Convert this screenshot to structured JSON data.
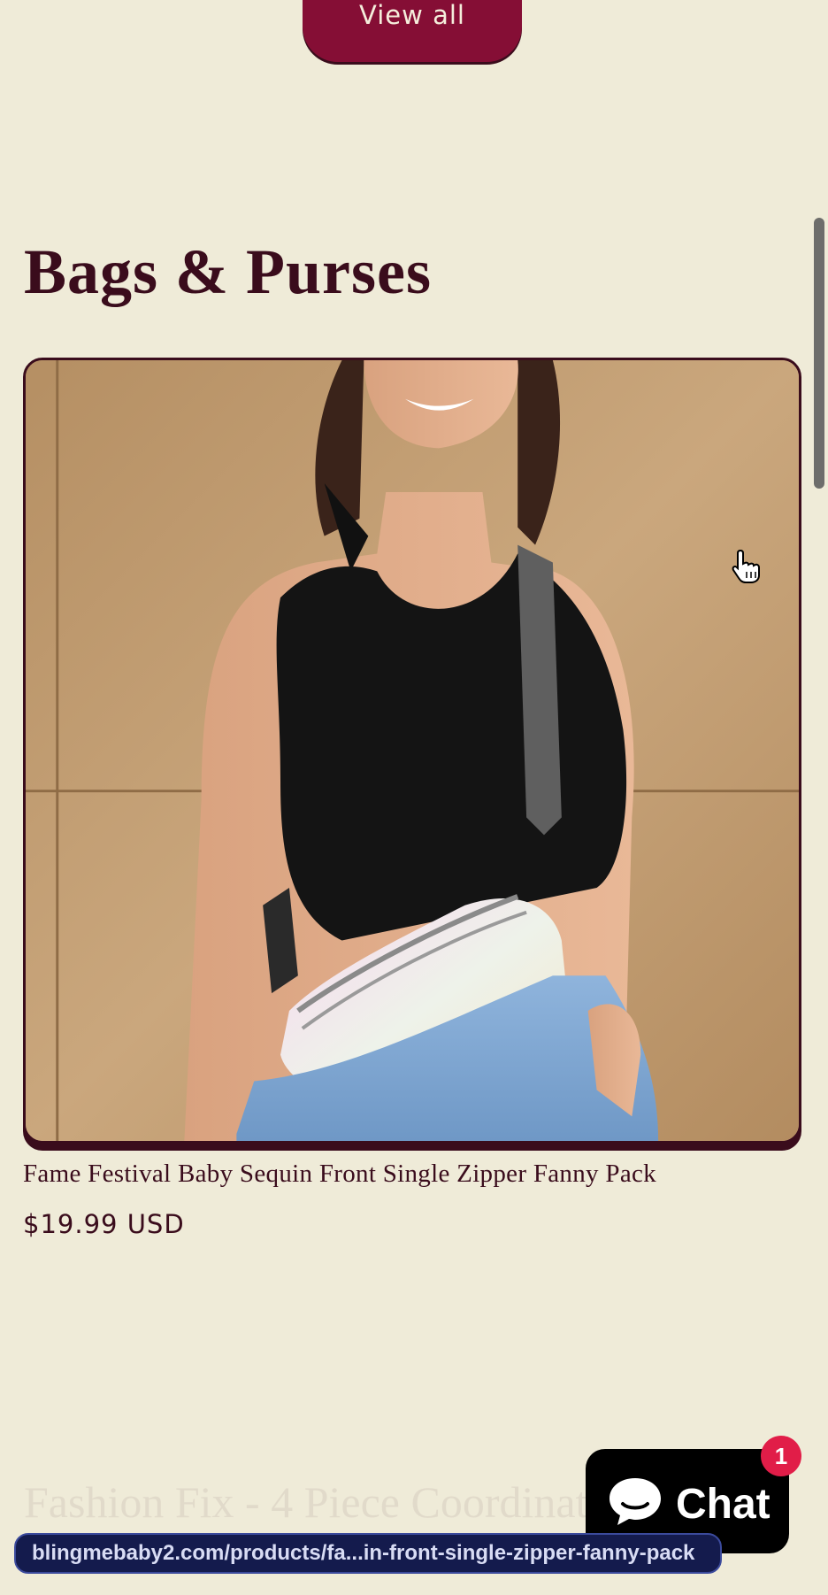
{
  "top_button": {
    "label": "View all"
  },
  "section": {
    "title": "Bags & Purses"
  },
  "product": {
    "name": "Fame Festival Baby Sequin Front Single Zipper Fanny Pack",
    "price": "$19.99 USD"
  },
  "next_section": {
    "title": "Fashion Fix - 4 Piece Coordinat"
  },
  "chat": {
    "label": "Chat",
    "badge_count": "1"
  },
  "status_bar": {
    "url": "blingmebaby2.com/products/fa...in-front-single-zipper-fanny-pack"
  },
  "colors": {
    "background": "#efebd8",
    "accent": "#850e35",
    "text": "#3a0c1c",
    "badge": "#e11d48"
  },
  "icons": {
    "cursor": "hand-pointer-icon",
    "chat": "chat-bubble-icon"
  }
}
